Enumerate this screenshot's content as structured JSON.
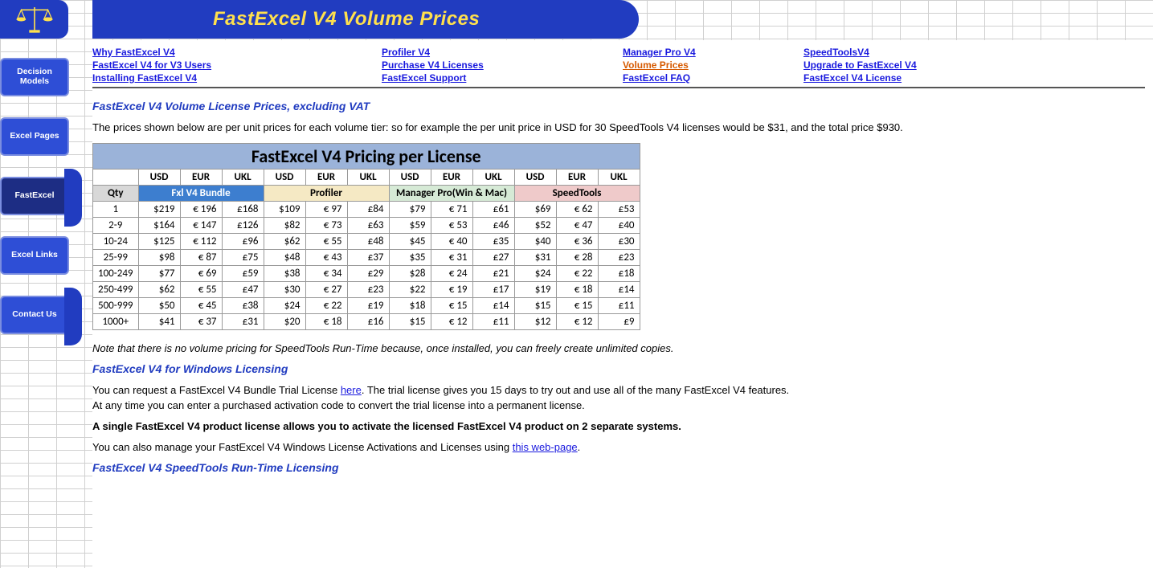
{
  "banner": {
    "title": "FastExcel V4 Volume Prices"
  },
  "sidebar": [
    {
      "label": "Decision Models"
    },
    {
      "label": "Excel Pages"
    },
    {
      "label": "FastExcel"
    },
    {
      "label": "Excel Links"
    },
    {
      "label": "Contact Us"
    }
  ],
  "nav": {
    "col1": {
      "a": "Why FastExcel V4",
      "b": "FastExcel V4 for V3 Users",
      "c": "Installing FastExcel V4"
    },
    "col2": {
      "a": "Profiler V4",
      "b": "Purchase V4 Licenses",
      "c": "FastExcel Support"
    },
    "col3": {
      "a": "Manager Pro V4",
      "b": "Volume Prices",
      "c": "FastExcel FAQ"
    },
    "col4": {
      "a": "SpeedToolsV4",
      "b": "Upgrade to FastExcel V4",
      "c": "FastExcel V4 License"
    }
  },
  "headings": {
    "h1": "FastExcel V4 Volume License Prices, excluding VAT",
    "h2": "FastExcel V4 for Windows Licensing",
    "h3": "FastExcel V4 SpeedTools Run-Time Licensing"
  },
  "text": {
    "intro": "The prices shown below are per unit prices for each volume tier: so for example the per unit price in USD for 30 SpeedTools V4 licenses would be $31, and the total price $930.",
    "note": "Note that there is no volume pricing for SpeedTools Run-Time because, once installed, you can freely create unlimited copies",
    "note_suffix": ".",
    "trial_a": "You can request a FastExcel V4 Bundle Trial License ",
    "trial_link": "here",
    "trial_b": ". The trial license gives you 15 days to try out and use all of the many FastExcel V4 features.",
    "trial_c": "At any time you can enter a purchased activation code to convert the trial license into a permanent license.",
    "bold": "A single FastExcel V4 product license allows you to activate the licensed FastExcel V4 product on 2 separate systems.",
    "manage_a": "You can also manage your FastExcel V4 Windows License Activations and Licenses using ",
    "manage_link": "this web-page",
    "manage_b": "."
  },
  "chart_data": {
    "type": "table",
    "title": "FastExcel V4  Pricing per License",
    "currency_headers": [
      "USD",
      "EUR",
      "UKL",
      "USD",
      "EUR",
      "UKL",
      "USD",
      "EUR",
      "UKL",
      "USD",
      "EUR",
      "UKL"
    ],
    "qty_label": "Qty",
    "groups": [
      "Fxl V4 Bundle",
      "Profiler",
      "Manager Pro(Win & Mac)",
      "SpeedTools"
    ],
    "rows": [
      {
        "qty": "1",
        "v": [
          "$219",
          "€ 196",
          "£168",
          "$109",
          "€ 97",
          "£84",
          "$79",
          "€ 71",
          "£61",
          "$69",
          "€ 62",
          "£53"
        ]
      },
      {
        "qty": "2-9",
        "v": [
          "$164",
          "€ 147",
          "£126",
          "$82",
          "€ 73",
          "£63",
          "$59",
          "€ 53",
          "£46",
          "$52",
          "€ 47",
          "£40"
        ]
      },
      {
        "qty": "10-24",
        "v": [
          "$125",
          "€ 112",
          "£96",
          "$62",
          "€ 55",
          "£48",
          "$45",
          "€ 40",
          "£35",
          "$40",
          "€ 36",
          "£30"
        ]
      },
      {
        "qty": "25-99",
        "v": [
          "$98",
          "€ 87",
          "£75",
          "$48",
          "€ 43",
          "£37",
          "$35",
          "€ 31",
          "£27",
          "$31",
          "€ 28",
          "£23"
        ]
      },
      {
        "qty": "100-249",
        "v": [
          "$77",
          "€ 69",
          "£59",
          "$38",
          "€ 34",
          "£29",
          "$28",
          "€ 24",
          "£21",
          "$24",
          "€ 22",
          "£18"
        ]
      },
      {
        "qty": "250-499",
        "v": [
          "$62",
          "€ 55",
          "£47",
          "$30",
          "€ 27",
          "£23",
          "$22",
          "€ 19",
          "£17",
          "$19",
          "€ 18",
          "£14"
        ]
      },
      {
        "qty": "500-999",
        "v": [
          "$50",
          "€ 45",
          "£38",
          "$24",
          "€ 22",
          "£19",
          "$18",
          "€ 15",
          "£14",
          "$15",
          "€ 15",
          "£11"
        ]
      },
      {
        "qty": "1000+",
        "v": [
          "$41",
          "€ 37",
          "£31",
          "$20",
          "€ 18",
          "£16",
          "$15",
          "€ 12",
          "£11",
          "$12",
          "€ 12",
          "£9"
        ]
      }
    ]
  }
}
